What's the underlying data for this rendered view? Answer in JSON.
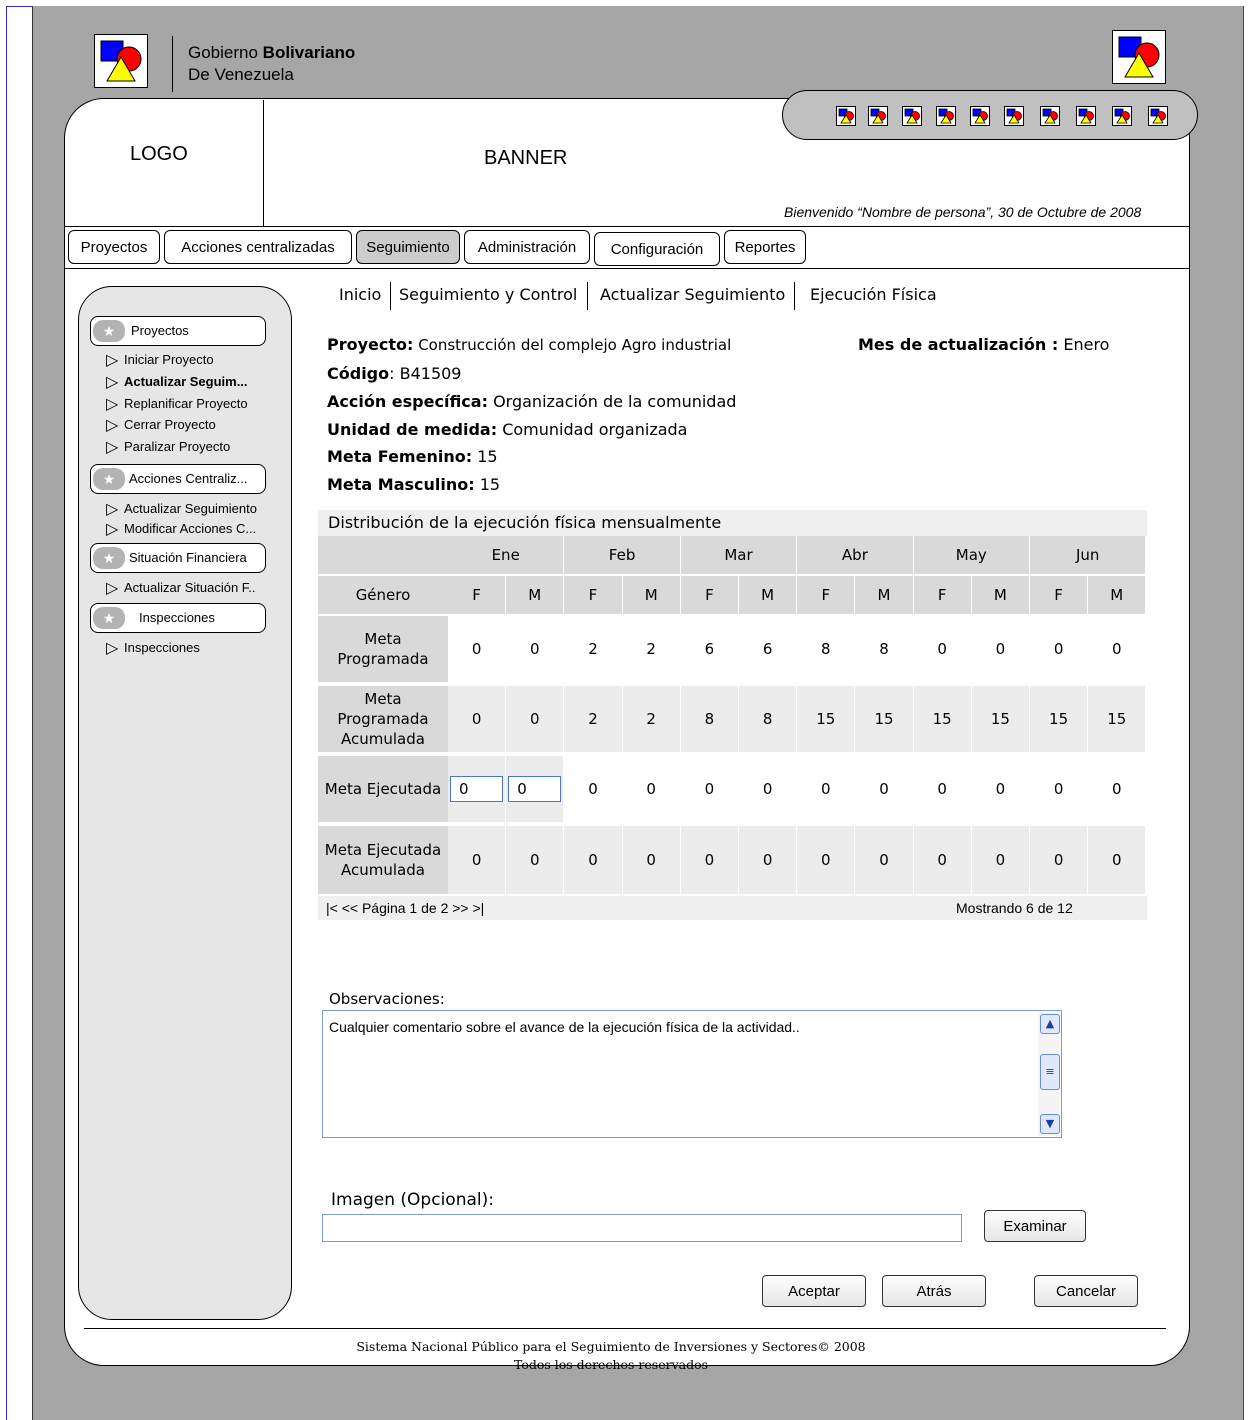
{
  "government": {
    "line1_normal": "Gobierno ",
    "line1_bold": "Bolivariano",
    "line2": "De Venezuela"
  },
  "header": {
    "logo": "LOGO",
    "banner": "BANNER",
    "welcome": "Bienvenido “Nombre de persona”, 30 de Octubre de 2008"
  },
  "tabs": [
    "Proyectos",
    "Acciones centralizadas",
    "Seguimiento",
    "Administración",
    "Configuración",
    "Reportes"
  ],
  "sidebar": {
    "sections": [
      {
        "title": "Proyectos",
        "items": [
          "Iniciar Proyecto",
          "Actualizar Seguim...",
          "Replanificar Proyecto",
          "Cerrar Proyecto",
          "Paralizar Proyecto"
        ]
      },
      {
        "title": "Acciones Centraliz...",
        "items": [
          "Actualizar Seguimiento",
          "Modificar Acciones C..."
        ]
      },
      {
        "title": "Situación Financiera",
        "items": [
          "Actualizar Situación F.."
        ]
      },
      {
        "title": "Inspecciones",
        "items": [
          "Inspecciones"
        ]
      }
    ],
    "active_item": "Actualizar Seguim..."
  },
  "breadcrumb": [
    "Inicio",
    "Seguimiento y Control",
    "Actualizar Seguimiento",
    "Ejecución Física"
  ],
  "project": {
    "proyecto_label": "Proyecto:",
    "proyecto_value": " Construcción del complejo Agro industrial",
    "mes_label": "Mes de actualización :",
    "mes_value": " Enero",
    "codigo_label": "Código",
    "codigo_value": ": B41509",
    "accion_label": "Acción específica:",
    "accion_value": " Organización de la comunidad",
    "unidad_label": "Unidad de medida:",
    "unidad_value": " Comunidad organizada",
    "fem_label": "Meta Femenino:",
    "fem_value": " 15",
    "masc_label": "Meta Masculino:",
    "masc_value": " 15"
  },
  "table": {
    "caption": "Distribución de la ejecución física mensualmente",
    "months": [
      "Ene",
      "Feb",
      "Mar",
      "Abr",
      "May",
      "Jun"
    ],
    "gender_header": "Género",
    "sub_headers": [
      "F",
      "M",
      "F",
      "M",
      "F",
      "M",
      "F",
      "M",
      "F",
      "M",
      "F",
      "M"
    ],
    "rows": [
      {
        "label": "Meta Programada",
        "values": [
          "0",
          "0",
          "2",
          "2",
          "6",
          "6",
          "8",
          "8",
          "0",
          "0",
          "0",
          "0"
        ]
      },
      {
        "label": "Meta Programada Acumulada",
        "values": [
          "0",
          "0",
          "2",
          "2",
          "8",
          "8",
          "15",
          "15",
          "15",
          "15",
          "15",
          "15"
        ]
      },
      {
        "label": "Meta Ejecutada",
        "values": [
          "0",
          "0",
          "0",
          "0",
          "0",
          "0",
          "0",
          "0",
          "0",
          "0",
          "0",
          "0"
        ],
        "editable_count": 2
      },
      {
        "label": "Meta Ejecutada Acumulada",
        "values": [
          "0",
          "0",
          "0",
          "0",
          "0",
          "0",
          "0",
          "0",
          "0",
          "0",
          "0",
          "0"
        ]
      }
    ],
    "pager": "|<  << Página 1 de 2 >>  >|",
    "showing": "Mostrando  6 de 12"
  },
  "observaciones": {
    "label": "Observaciones:",
    "text": "Cualquier comentario sobre el avance de la ejecución física de la actividad.."
  },
  "imagen": {
    "label": "Imagen  (Opcional):",
    "value": "",
    "browse_button": "Examinar"
  },
  "buttons": {
    "accept": "Aceptar",
    "back": "Atrás",
    "cancel": "Cancelar"
  },
  "footer": {
    "line1": "Sistema Nacional Público para el Seguimiento de Inversiones y Sectores© 2008",
    "line2": "Todos los derechos reservados"
  },
  "colors": {
    "frame": "#2f2fd6",
    "background": "#a6a6a6",
    "sidebar": "#e6e6e6",
    "icon_blue": "#0000ff",
    "icon_red": "#ff0000",
    "icon_yellow": "#ffff00"
  }
}
